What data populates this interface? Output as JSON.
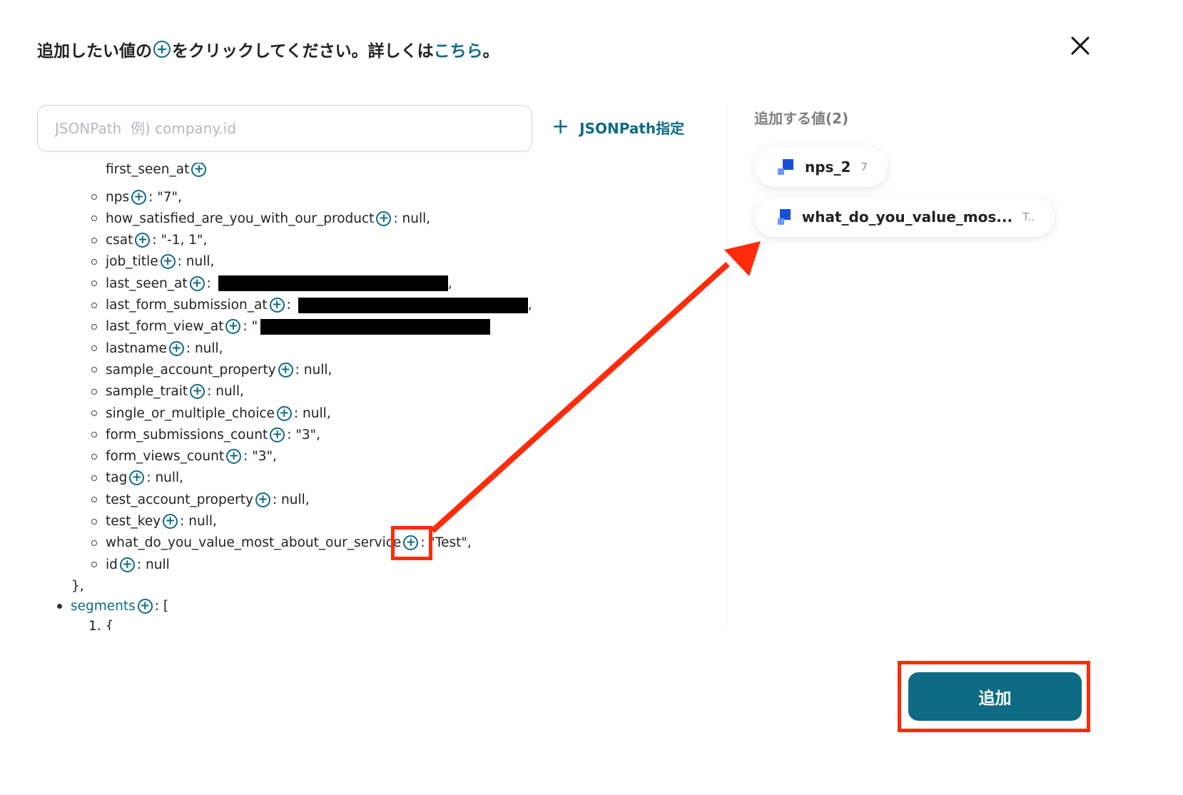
{
  "header": {
    "text_before": "追加したい値の",
    "text_after": "をクリックしてください。詳しくは",
    "link_text": "こちら",
    "text_end": "。"
  },
  "search": {
    "placeholder": "JSONPath  例) company.id"
  },
  "jsonpath_button": {
    "label": "JSONPath指定"
  },
  "tree": {
    "partial_top": "first_seen_at",
    "rows": [
      {
        "key": "nps",
        "value": ": \"7\","
      },
      {
        "key": "how_satisfied_are_you_with_our_product",
        "value": ": null,"
      },
      {
        "key": "csat",
        "value": ": \"-1, 1\","
      },
      {
        "key": "job_title",
        "value": ": null,"
      },
      {
        "key": "last_seen_at",
        "value": ":",
        "tail": ","
      },
      {
        "key": "last_form_submission_at",
        "value": ":",
        "tail": ","
      },
      {
        "key": "last_form_view_at",
        "value": ": \""
      },
      {
        "key": "lastname",
        "value": ": null,"
      },
      {
        "key": "sample_account_property",
        "value": ": null,"
      },
      {
        "key": "sample_trait",
        "value": ": null,"
      },
      {
        "key": "single_or_multiple_choice",
        "value": ": null,"
      },
      {
        "key": "form_submissions_count",
        "value": ": \"3\","
      },
      {
        "key": "form_views_count",
        "value": ": \"3\","
      },
      {
        "key": "tag",
        "value": ": null,"
      },
      {
        "key": "test_account_property",
        "value": ": null,"
      },
      {
        "key": "test_key",
        "value": ": null,"
      },
      {
        "key": "what_do_you_value_most_about_our_service",
        "value": ": \"Test\","
      },
      {
        "key": "id",
        "value": ": null"
      }
    ],
    "closing": "},",
    "segments_key": "segments",
    "segments_value": ": [",
    "partial_bottom": "1. {"
  },
  "added_panel": {
    "title": "追加する値(2)",
    "chips": [
      {
        "name": "nps_2",
        "value": "7"
      },
      {
        "name": "what_do_you_value_mos...",
        "value": "T.."
      }
    ]
  },
  "add_button": {
    "label": "追加"
  },
  "colors": {
    "accent": "#0e6b85",
    "highlight": "#ff2b0a",
    "chip_icon": "#1a4fd8"
  }
}
